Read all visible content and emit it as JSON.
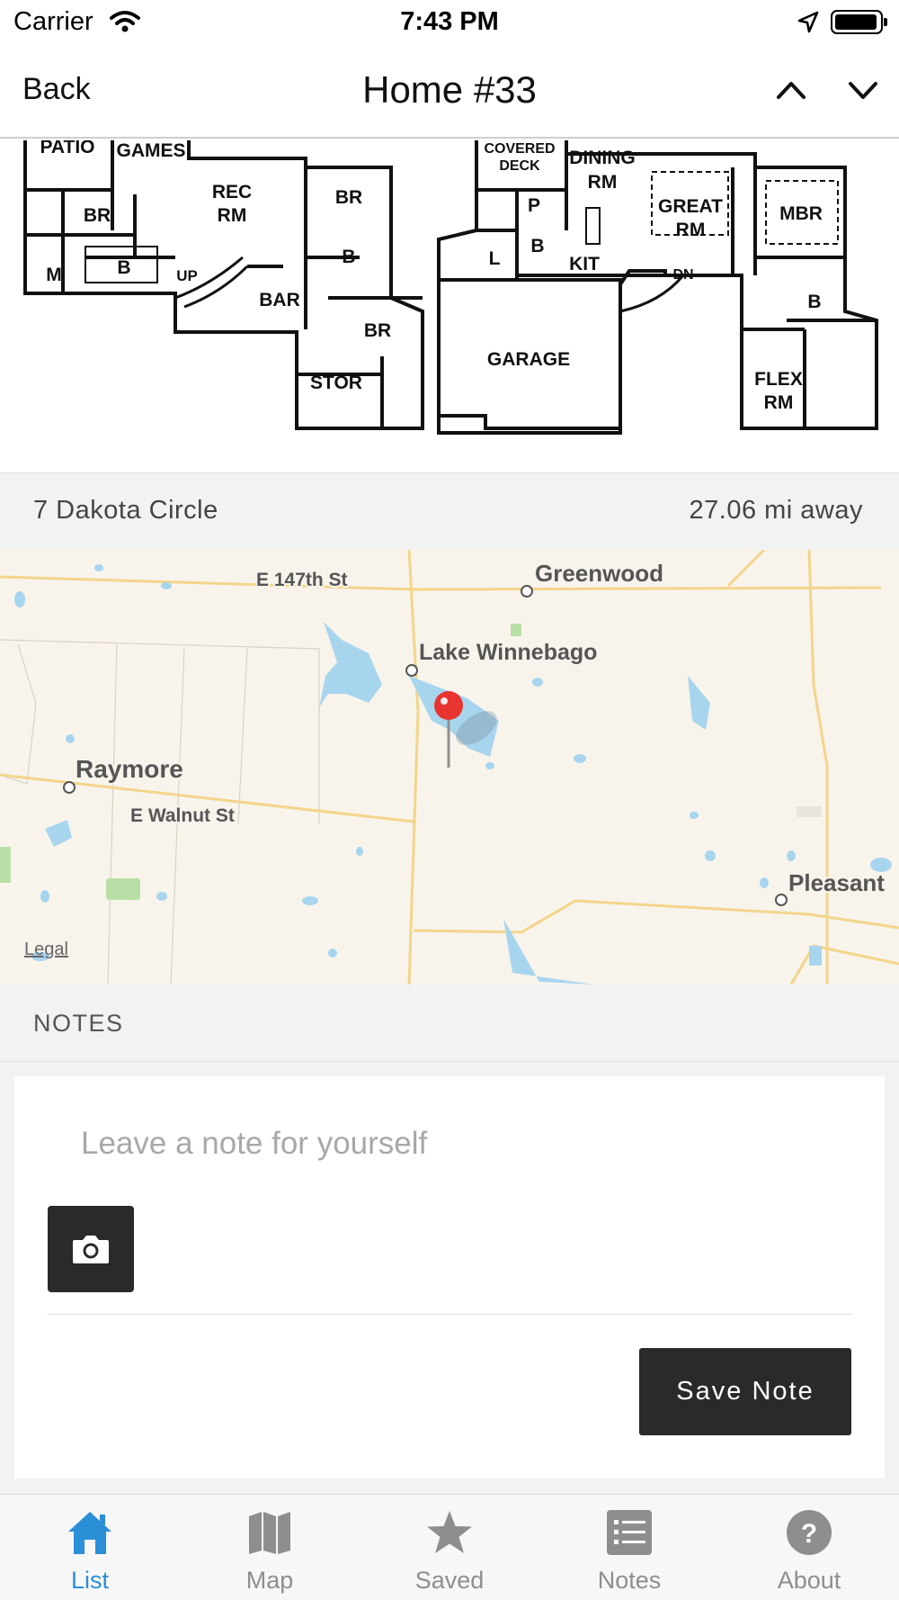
{
  "status_bar": {
    "carrier": "Carrier",
    "time": "7:43 PM",
    "icons": [
      "wifi-icon",
      "location-arrow-icon",
      "battery-icon"
    ]
  },
  "nav": {
    "back_label": "Back",
    "title": "Home #33",
    "prev_icon": "chevron-up-icon",
    "next_icon": "chevron-down-icon"
  },
  "floorplan": {
    "room_labels": [
      "PATIO",
      "GAMES",
      "REC",
      "RM",
      "BR",
      "BR",
      "M",
      "B",
      "UP",
      "BAR",
      "B",
      "BR",
      "STOR",
      "COVERED",
      "DECK",
      "DINING",
      "RM",
      "P",
      "B",
      "L",
      "KIT",
      "GREAT",
      "RM",
      "MBR",
      "DN",
      "B",
      "FLEX",
      "RM",
      "GARAGE"
    ]
  },
  "listing": {
    "address": "7 Dakota Circle",
    "distance": "27.06 mi away"
  },
  "map": {
    "labels": {
      "street1": "E 147th St",
      "city1": "Greenwood",
      "lake": "Lake Winnebago",
      "city2": "Raymore",
      "street2": "E Walnut St",
      "city3": "Pleasant"
    },
    "legal": "Legal",
    "pin_color": "#e8332f",
    "water_color": "#a8d5ee",
    "road_color": "#f5d98a"
  },
  "notes": {
    "header": "NOTES",
    "placeholder": "Leave a note for yourself",
    "save_label": "Save Note",
    "camera_icon": "camera-icon"
  },
  "tabs": [
    {
      "label": "List",
      "icon": "home-icon",
      "active": true
    },
    {
      "label": "Map",
      "icon": "map-icon",
      "active": false
    },
    {
      "label": "Saved",
      "icon": "star-icon",
      "active": false
    },
    {
      "label": "Notes",
      "icon": "notes-list-icon",
      "active": false
    },
    {
      "label": "About",
      "icon": "question-icon",
      "active": false
    }
  ],
  "colors": {
    "accent": "#2b8fd7",
    "inactive": "#8e8e8e",
    "button_dark": "#2a2a2a",
    "section_bg": "#f2f2f2"
  }
}
